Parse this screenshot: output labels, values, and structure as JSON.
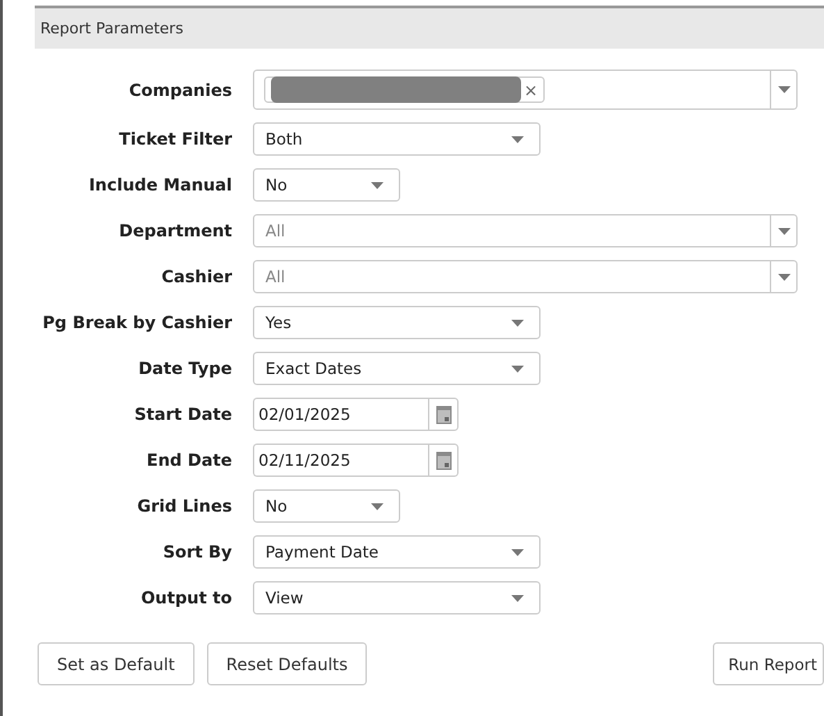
{
  "panel": {
    "title": "Report Parameters"
  },
  "fields": [
    {
      "label": "Companies",
      "kind": "multiselect",
      "tags": [
        {
          "redacted": true,
          "remove": "×"
        }
      ]
    },
    {
      "label": "Ticket Filter",
      "kind": "select",
      "value": "Both"
    },
    {
      "label": "Include Manual",
      "kind": "shortselect",
      "value": "No"
    },
    {
      "label": "Department",
      "kind": "combobox",
      "placeholder": "All"
    },
    {
      "label": "Cashier",
      "kind": "combobox",
      "placeholder": "All"
    },
    {
      "label": "Pg Break by Cashier",
      "kind": "select",
      "value": "Yes"
    },
    {
      "label": "Date Type",
      "kind": "select",
      "value": "Exact Dates"
    },
    {
      "label": "Start Date",
      "kind": "date",
      "value": "02/01/2025"
    },
    {
      "label": "End Date",
      "kind": "date",
      "value": "02/11/2025"
    },
    {
      "label": "Grid Lines",
      "kind": "shortselect",
      "value": "No"
    },
    {
      "label": "Sort By",
      "kind": "select",
      "value": "Payment Date"
    },
    {
      "label": "Output to",
      "kind": "select",
      "value": "View"
    }
  ],
  "left_buttons": [
    {
      "label": "Set as Default"
    },
    {
      "label": "Reset Defaults"
    }
  ],
  "right_buttons": [
    {
      "label": "Run Report"
    }
  ]
}
